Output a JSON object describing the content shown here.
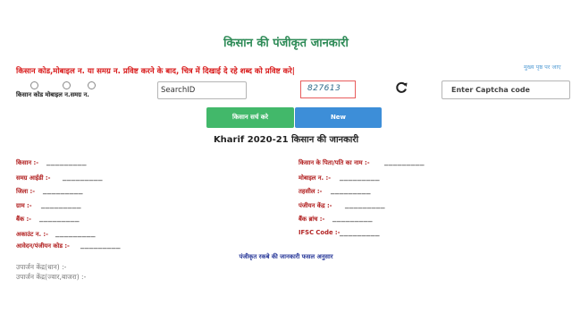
{
  "page": {
    "title": "किसान की पंजीकृत जानकारी",
    "instruction": "किसान कोड,मोबाइल न. या समग्र न. प्रविष्ट करने के बाद, चित्र में दिखाई दे रहे शब्द को प्रविष्ट करे|",
    "home_link": "मुख्य पृष्ठ पर जाए"
  },
  "search": {
    "radio_label": "किसान कोड मोबाइल न.समग्र न.",
    "input_value": "SearchID",
    "captcha_text": "827613",
    "captcha_placeholder": "Enter Captcha code",
    "search_button": "किसान सर्च करे",
    "new_button": "New"
  },
  "details": {
    "heading": "Kharif 2020-21 किसान की जानकारी",
    "blank": "_________",
    "left_fields": [
      "किसान :-",
      "समग्र आईडी :-",
      "जिला :-",
      "ग्राम :-",
      "बैंक :-",
      "अकाउंट न. :-",
      "आवेदन/पंजीयन कोड :-"
    ],
    "right_fields": [
      "किसान के पिता/पति का नाम :-",
      "मोबाइल न. :-",
      "तहसील :-",
      "पंजीयन केंद्र :-",
      "बैंक ब्रांच :-",
      "IFSC Code :-"
    ],
    "crop_note": "पंजीकृत रकबे की जानकारी फसल अनुसार"
  },
  "footer": {
    "line1": "उपार्जन केंद्र(धान) :-",
    "line2": "उपार्जन केंद्र(ज्वार,बाजरा) :-"
  },
  "colors": {
    "title_green": "#2e8b57",
    "instruction_red": "#d91d1d",
    "label_red": "#b22222",
    "button_green": "#42b86a",
    "button_blue": "#3d8ed8",
    "link_blue": "#5aa0d6"
  }
}
